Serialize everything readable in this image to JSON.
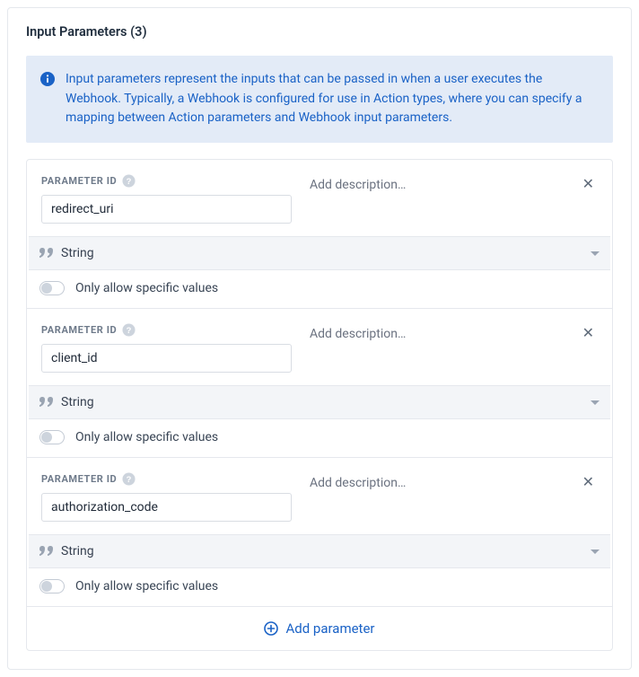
{
  "header": {
    "title": "Input Parameters (3)"
  },
  "info": {
    "text": "Input parameters represent the inputs that can be passed in when a user executes the Webhook. Typically, a Webhook is configured for use in Action types, where you can specify a mapping between Action parameters and Webhook input parameters."
  },
  "labels": {
    "parameter_id": "PARAMETER ID",
    "add_description": "Add description…",
    "only_specific": "Only allow specific values",
    "add_parameter": "Add parameter"
  },
  "parameters": [
    {
      "id_value": "redirect_uri",
      "type": "String"
    },
    {
      "id_value": "client_id",
      "type": "String"
    },
    {
      "id_value": "authorization_code",
      "type": "String"
    }
  ]
}
